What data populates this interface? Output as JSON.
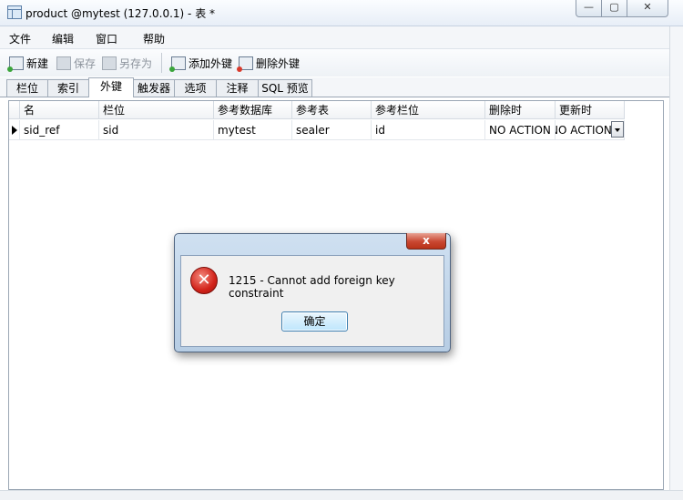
{
  "window": {
    "title": "product @mytest (127.0.0.1) - 表 *",
    "minimize_glyph": "—",
    "maximize_glyph": "▢",
    "close_glyph": "✕"
  },
  "menubar": {
    "items": [
      "文件",
      "编辑",
      "窗口",
      "帮助"
    ]
  },
  "toolbar": {
    "new_label": "新建",
    "save_label": "保存",
    "save_as_label": "另存为",
    "add_fk_label": "添加外键",
    "delete_fk_label": "删除外键"
  },
  "tabs": {
    "items": [
      "栏位",
      "索引",
      "外键",
      "触发器",
      "选项",
      "注释",
      "SQL 预览"
    ],
    "active": "外键"
  },
  "grid": {
    "columns": [
      "名",
      "栏位",
      "参考数据库",
      "参考表",
      "参考栏位",
      "删除时",
      "更新时"
    ],
    "rows": [
      [
        "sid_ref",
        "sid",
        "mytest",
        "sealer",
        "id",
        "NO ACTION",
        "NO ACTION"
      ]
    ]
  },
  "dialog": {
    "close_glyph": "x",
    "icon": "error-icon",
    "icon_glyph": "✕",
    "message": "1215 - Cannot add foreign key constraint",
    "ok_label": "确定"
  }
}
